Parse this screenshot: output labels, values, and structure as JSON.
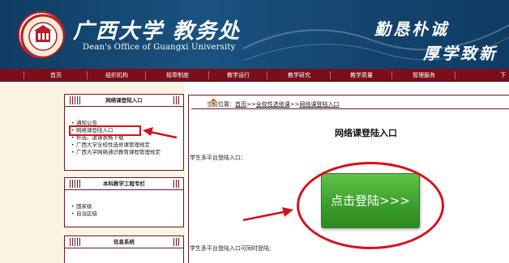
{
  "header": {
    "title_cn": "广西大学 教务处",
    "title_en": "Dean's Office of Guangxi University",
    "motto_line1": "勤恳朴诚",
    "motto_line2": "厚学致新"
  },
  "nav": {
    "items": [
      "首页",
      "组织机构",
      "规章制度",
      "教学运行",
      "教学研究",
      "教学质量",
      "管理服务",
      "下"
    ]
  },
  "sidebar": {
    "box1": {
      "title": "网络课登陆入口",
      "items": [
        "通知公告",
        "网络课登陆入口",
        "补选、退课表格下载",
        "广西大学全校性选修课管理规定",
        "广西大学网络通识教育课程管理规定"
      ]
    },
    "box2": {
      "title": "本科教学工程专栏",
      "items": [
        "国家级",
        "自治区级"
      ]
    },
    "box3": {
      "title": "信息系统"
    }
  },
  "breadcrumb": {
    "prefix": "当前位置：",
    "home": "首页",
    "sep1": ">>",
    "level1": "全校性选修课",
    "sep2": ">>",
    "level2": "网络课登陆入口"
  },
  "main": {
    "title": "网络课登陆入口",
    "text1": "学生多平台登陆入口：",
    "login_button": "点击登陆>>>",
    "text2": "学生多平台登陆入口可同时登陆："
  },
  "colors": {
    "header_blue": "#14456f",
    "nav_maroon": "#7a0f1b",
    "annotation_red": "#d6101c",
    "button_green": "#3a9e2a"
  },
  "icons": {
    "home": "house-icon",
    "logo": "university-seal-icon"
  }
}
